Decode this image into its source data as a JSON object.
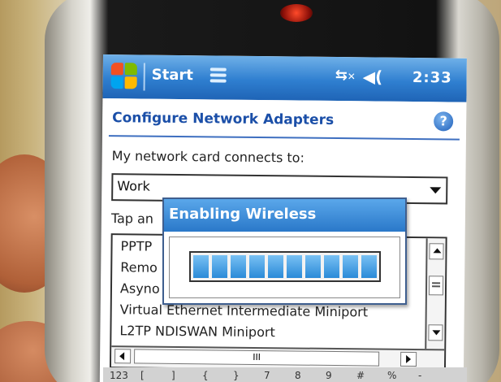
{
  "status_bar": {
    "start_label": "Start",
    "time": "2:33",
    "connectivity_icon": "network-disconnected-icon",
    "volume_icon": "speaker-icon",
    "notification_icon": "notification-icon"
  },
  "page": {
    "title": "Configure Network Adapters",
    "help_icon": "help-icon",
    "connects_label": "My network card connects to:",
    "connects_value": "Work",
    "tap_label_partial": "Tap an"
  },
  "adapter_list": {
    "items": [
      "PPTP",
      "Remo",
      "Asyno",
      "Virtual Ethernet Intermediate Miniport",
      "L2TP NDISWAN Miniport"
    ],
    "hscroll_thumb_label": "III"
  },
  "dialog": {
    "title": "Enabling Wireless",
    "progress_segments_filled": 10,
    "progress_segments_total": 10
  },
  "input_panel": {
    "keys": [
      "123",
      "[",
      "]",
      "{",
      "}",
      "7",
      "8",
      "9",
      "#",
      "%",
      "-"
    ]
  },
  "colors": {
    "titlebar": "#2f7fd0",
    "heading": "#1b4fa8",
    "progress": "#2a8ad8"
  }
}
